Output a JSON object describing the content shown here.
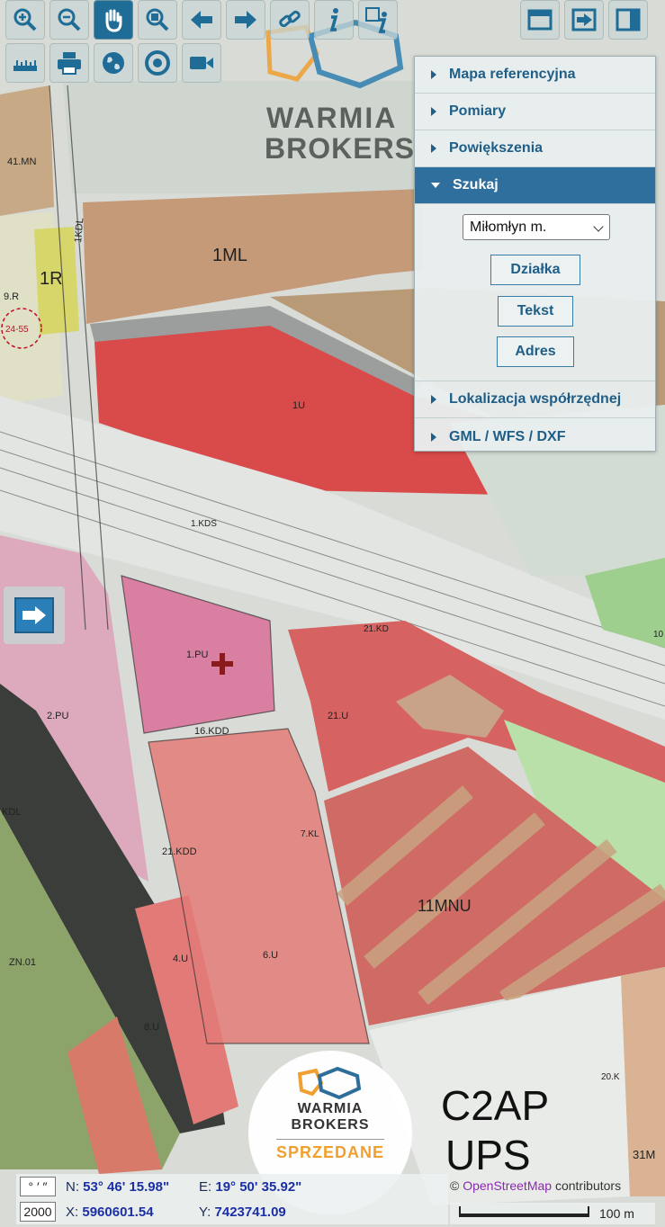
{
  "toolbar": {
    "row1": [
      "zoom-in-icon",
      "zoom-out-icon",
      "pan-hand-icon",
      "zoom-box-icon",
      "back-arrow-icon",
      "forward-arrow-icon",
      "link-icon",
      "info-icon",
      "info-copy-icon"
    ],
    "row2": [
      "ruler-icon",
      "print-icon",
      "globe-icon",
      "target-icon",
      "video-icon"
    ],
    "right": [
      "window-icon",
      "share-arrow-icon",
      "panel-toggle-icon"
    ]
  },
  "watermark": {
    "line1": "WARMIA",
    "line2": "BROKERS"
  },
  "panel": {
    "items": [
      {
        "label": "Mapa referencyjna"
      },
      {
        "label": "Pomiary"
      },
      {
        "label": "Powiększenia"
      },
      {
        "label": "Szukaj"
      },
      {
        "label": "Lokalizacja współrzędnej"
      },
      {
        "label": "GML / WFS / DXF"
      }
    ],
    "search": {
      "selected_town": "Miłomłyn m.",
      "buttons": [
        "Działka",
        "Tekst",
        "Adres"
      ]
    }
  },
  "map_labels": {
    "l41mn": "41.MN",
    "l1ml": "1ML",
    "l1r": "1R",
    "l9r": "9.R",
    "l24": "24-55",
    "lkdl": "1KDL",
    "l1u": "1U",
    "l1kds": "1.KDS",
    "l1pu": "1.PU",
    "l2pu": "2.PU",
    "l16kdd": "16.KDD",
    "l21u": "21.U",
    "l21kdd": "21.KDD",
    "l11mnu": "11MNU",
    "lzn01": "ZN.01",
    "l4u": "4.U",
    "l6u": "6.U",
    "l8u": "8.U",
    "lkdl2": "KDL",
    "l2ap": "C2AP",
    "lups": "UPS",
    "l31m": "31M",
    "l20k": "20.K",
    "l10": "10",
    "l21kd": "21.KD",
    "l7kl": "7.KL"
  },
  "badge": {
    "line1": "WARMIA",
    "line2": "BROKERS",
    "status": "SPRZEDANE"
  },
  "coords": {
    "format_label": "° ′ ″",
    "epsg": "2000",
    "n_label": "N:",
    "n_value": "53° 46' 15.98\"",
    "e_label": "E:",
    "e_value": "19° 50' 35.92\"",
    "x_label": "X:",
    "x_value": "5960601.54",
    "y_label": "Y:",
    "y_value": "7423741.09"
  },
  "attribution": {
    "prefix": "©",
    "osm": "OpenStreetMap",
    "suffix": " contributors"
  },
  "scale": {
    "label": "100 m"
  },
  "colors": {
    "accent": "#2e6f9e",
    "red_zone": "#d94a4a",
    "pink_zone": "#d98aa6",
    "brown_zone": "#c59a78",
    "yellow_zone": "#d8d96a"
  }
}
